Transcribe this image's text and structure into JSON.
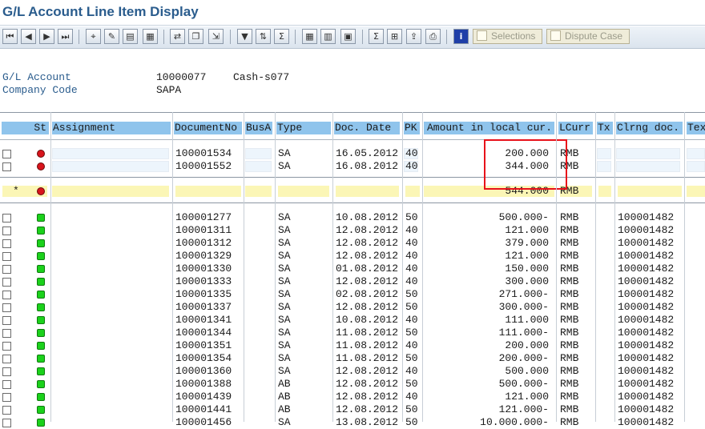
{
  "window": {
    "title": "G/L Account Line Item Display"
  },
  "toolbar": {
    "selections_label": "Selections",
    "dispute_label": "Dispute Case",
    "icons": [
      "first-page-icon",
      "previous-page-icon",
      "next-page-icon",
      "last-page-icon",
      "choose-icon",
      "edit-icon",
      "display-document-icon",
      "ledger-icon",
      "change-icon",
      "copy-icon",
      "transfer-icon",
      "filter-icon",
      "sort-icon",
      "subtotal-icon",
      "layout-grid-icon",
      "change-layout-icon",
      "save-layout-icon",
      "sum-icon",
      "select-layout-icon",
      "export-icon",
      "print-icon",
      "info-icon"
    ]
  },
  "header": {
    "gl_account_label": "G/L Account",
    "gl_account_value": "10000077",
    "gl_account_desc": "Cash-s077",
    "company_code_label": "Company Code",
    "company_code_value": "SAPA"
  },
  "columns": [
    "St",
    "Assignment",
    "DocumentNo",
    "BusA",
    "Type",
    "Doc. Date",
    "PK",
    "Amount in local cur.",
    "LCurr",
    "Tx",
    "Clrng doc.",
    "Tex"
  ],
  "open_items": [
    {
      "doc": "100001534",
      "type": "SA",
      "date": "16.05.2012",
      "pk": "40",
      "amount": "200.000",
      "curr": "RMB"
    },
    {
      "doc": "100001552",
      "type": "SA",
      "date": "16.08.2012",
      "pk": "40",
      "amount": "344.000",
      "curr": "RMB"
    }
  ],
  "subtotal": {
    "marker": "*",
    "amount": "544.000",
    "curr": "RMB"
  },
  "cleared_items": [
    {
      "doc": "100001277",
      "type": "SA",
      "date": "10.08.2012",
      "pk": "50",
      "amount": "500.000-",
      "curr": "RMB",
      "clr": "100001482"
    },
    {
      "doc": "100001311",
      "type": "SA",
      "date": "12.08.2012",
      "pk": "40",
      "amount": "121.000",
      "curr": "RMB",
      "clr": "100001482"
    },
    {
      "doc": "100001312",
      "type": "SA",
      "date": "12.08.2012",
      "pk": "40",
      "amount": "379.000",
      "curr": "RMB",
      "clr": "100001482"
    },
    {
      "doc": "100001329",
      "type": "SA",
      "date": "12.08.2012",
      "pk": "40",
      "amount": "121.000",
      "curr": "RMB",
      "clr": "100001482"
    },
    {
      "doc": "100001330",
      "type": "SA",
      "date": "01.08.2012",
      "pk": "40",
      "amount": "150.000",
      "curr": "RMB",
      "clr": "100001482"
    },
    {
      "doc": "100001333",
      "type": "SA",
      "date": "12.08.2012",
      "pk": "40",
      "amount": "300.000",
      "curr": "RMB",
      "clr": "100001482"
    },
    {
      "doc": "100001335",
      "type": "SA",
      "date": "02.08.2012",
      "pk": "50",
      "amount": "271.000-",
      "curr": "RMB",
      "clr": "100001482"
    },
    {
      "doc": "100001337",
      "type": "SA",
      "date": "12.08.2012",
      "pk": "50",
      "amount": "300.000-",
      "curr": "RMB",
      "clr": "100001482"
    },
    {
      "doc": "100001341",
      "type": "SA",
      "date": "10.08.2012",
      "pk": "40",
      "amount": "111.000",
      "curr": "RMB",
      "clr": "100001482"
    },
    {
      "doc": "100001344",
      "type": "SA",
      "date": "11.08.2012",
      "pk": "50",
      "amount": "111.000-",
      "curr": "RMB",
      "clr": "100001482"
    },
    {
      "doc": "100001351",
      "type": "SA",
      "date": "11.08.2012",
      "pk": "40",
      "amount": "200.000",
      "curr": "RMB",
      "clr": "100001482"
    },
    {
      "doc": "100001354",
      "type": "SA",
      "date": "11.08.2012",
      "pk": "50",
      "amount": "200.000-",
      "curr": "RMB",
      "clr": "100001482"
    },
    {
      "doc": "100001360",
      "type": "SA",
      "date": "12.08.2012",
      "pk": "40",
      "amount": "500.000",
      "curr": "RMB",
      "clr": "100001482"
    },
    {
      "doc": "100001388",
      "type": "AB",
      "date": "12.08.2012",
      "pk": "50",
      "amount": "500.000-",
      "curr": "RMB",
      "clr": "100001482"
    },
    {
      "doc": "100001439",
      "type": "AB",
      "date": "12.08.2012",
      "pk": "40",
      "amount": "121.000",
      "curr": "RMB",
      "clr": "100001482"
    },
    {
      "doc": "100001441",
      "type": "AB",
      "date": "12.08.2012",
      "pk": "50",
      "amount": "121.000-",
      "curr": "RMB",
      "clr": "100001482"
    },
    {
      "doc": "100001456",
      "type": "SA",
      "date": "13.08.2012",
      "pk": "50",
      "amount": "10.000.000-",
      "curr": "RMB",
      "clr": "100001482"
    }
  ],
  "colors": {
    "title": "#2a5c8d",
    "header_bg": "#8fc4ec",
    "subtotal_bg": "#fbf6b6",
    "highlight": "#e8121a",
    "red_status": "#d8141c",
    "green_status": "#1bd11b"
  }
}
